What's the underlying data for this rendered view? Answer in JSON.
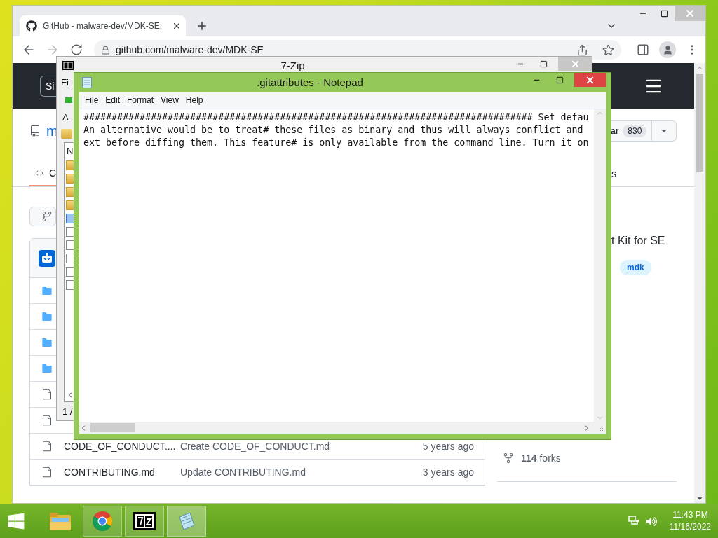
{
  "browser": {
    "tab": {
      "title": "GitHub - malware-dev/MDK-SE:",
      "selected": true
    },
    "address": "github.com/malware-dev/MDK-SE",
    "page": {
      "header_button": "Si",
      "repo_name": "m",
      "code_tab": {
        "label": "C",
        "selected": true
      },
      "side_tab": "s",
      "star_button": {
        "label": "ar",
        "count": "830"
      },
      "about": "t Kit for SE",
      "topics": [
        "mdk"
      ],
      "forks": "**114** forks",
      "files": [
        {
          "kind": "folder"
        },
        {
          "kind": "folder"
        },
        {
          "kind": "folder"
        },
        {
          "kind": "folder"
        },
        {
          "kind": "file"
        },
        {
          "kind": "file"
        },
        {
          "kind": "file",
          "name": "CODE_OF_CONDUCT....",
          "message": "Create CODE_OF_CONDUCT.md",
          "age": "5 years ago"
        },
        {
          "kind": "file",
          "name": "CONTRIBUTING.md",
          "message": "Update CONTRIBUTING.md",
          "age": "3 years ago"
        }
      ]
    }
  },
  "sevenzip": {
    "title": "7-Zip",
    "menu": "Fi",
    "address": "A",
    "column": "N",
    "status": "1 /",
    "items": [
      {
        "kind": "folder",
        "selected": false
      },
      {
        "kind": "folder",
        "selected": false
      },
      {
        "kind": "folder",
        "selected": false
      },
      {
        "kind": "folder",
        "selected": false
      },
      {
        "kind": "file",
        "selected": true
      },
      {
        "kind": "file",
        "selected": false
      },
      {
        "kind": "file",
        "selected": false
      },
      {
        "kind": "file",
        "selected": false
      },
      {
        "kind": "file",
        "selected": false
      },
      {
        "kind": "file",
        "selected": false
      }
    ]
  },
  "notepad": {
    "title": ".gitattributes - Notepad",
    "menu": [
      "File",
      "Edit",
      "Format",
      "View",
      "Help"
    ],
    "lines": [
      "################################################################################ Set defau",
      "An alternative would be to treat# these files as binary and thus will always conflict and",
      "ext before diffing them. This feature# is only available from the command line. Turn it on"
    ]
  },
  "taskbar": {
    "apps": [
      {
        "kind": "explorer",
        "running": false,
        "selected": false
      },
      {
        "kind": "chrome",
        "running": true,
        "selected": false
      },
      {
        "kind": "sevenzip",
        "running": true,
        "selected": false
      },
      {
        "kind": "notepad",
        "running": true,
        "selected": true
      }
    ],
    "time": "11:43 PM",
    "date": "11/16/2022"
  }
}
